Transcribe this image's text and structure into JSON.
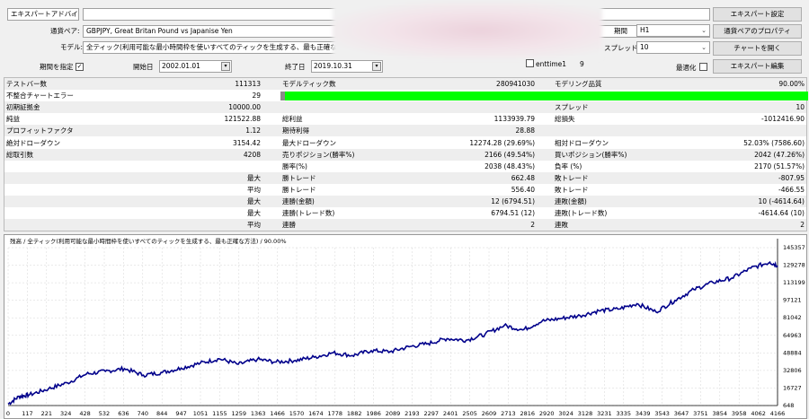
{
  "settings": {
    "expert_select": "エキスパートアドバイザ",
    "pair_label": "通貨ペア:",
    "pair_value": "GBPJPY, Great Britan Pound vs Japanise Yen",
    "model_label": "モデル:",
    "model_value": "全ティック(利用可能な最小時間枠を使いすべてのティックを生成する、最も正確な方法)",
    "use_date_label": "期間を指定",
    "use_date_checked": "✓",
    "from_label": "開始日",
    "from_value": "2002.01.01",
    "to_label": "終了日",
    "to_value": "2019.10.31",
    "param_label": "enttime1",
    "param_value": "9",
    "period_label": "期間",
    "period_value": "H1",
    "spread_label": "スプレッド",
    "spread_value": "10",
    "optimize_label": "最適化",
    "buttons": [
      "エキスパート設定",
      "通貨ペアのプロパティ",
      "チャートを開く",
      "エキスパート編集"
    ]
  },
  "stats": {
    "rows": [
      [
        "テストバー数",
        "111313",
        "モデルティック数",
        "280941030",
        "モデリング品質",
        "90.00%"
      ],
      [
        "不整合チャートエラー",
        "29",
        "",
        "",
        "",
        ""
      ],
      [
        "初期証拠金",
        "10000.00",
        "",
        "",
        "スプレッド",
        "10"
      ],
      [
        "純益",
        "121522.88",
        "総利益",
        "1133939.79",
        "総損失",
        "-1012416.90"
      ],
      [
        "プロフィットファクタ",
        "1.12",
        "期待利得",
        "28.88",
        "",
        ""
      ],
      [
        "絶対ドローダウン",
        "3154.42",
        "最大ドローダウン",
        "12274.28 (29.69%)",
        "相対ドローダウン",
        "52.03% (7586.60)"
      ],
      [
        "総取引数",
        "4208",
        "売りポジション(勝率%)",
        "2166 (49.54%)",
        "買いポジション(勝率%)",
        "2042 (47.26%)"
      ],
      [
        "",
        "",
        "勝率(%)",
        "2038 (48.43%)",
        "負率 (%)",
        "2170 (51.57%)"
      ],
      [
        "",
        "最大",
        "勝トレード",
        "662.48",
        "敗トレード",
        "-807.95"
      ],
      [
        "",
        "平均",
        "勝トレード",
        "556.40",
        "敗トレード",
        "-466.55"
      ],
      [
        "",
        "最大",
        "連勝(金額)",
        "12 (6794.51)",
        "連敗(金額)",
        "10 (-4614.64)"
      ],
      [
        "",
        "最大",
        "連勝(トレード数)",
        "6794.51 (12)",
        "連敗(トレード数)",
        "-4614.64 (10)"
      ],
      [
        "",
        "平均",
        "連勝",
        "2",
        "連敗",
        "2"
      ]
    ]
  },
  "chart_data": {
    "type": "line",
    "title": "残高 / 全ティック(利用可能な最小時間枠を使いすべてのティックを生成する、最も正確な方法) / 90.00%",
    "x_ticks": [
      "0",
      "117",
      "221",
      "324",
      "428",
      "532",
      "636",
      "740",
      "844",
      "947",
      "1051",
      "1155",
      "1259",
      "1363",
      "1466",
      "1570",
      "1674",
      "1778",
      "1882",
      "1986",
      "2089",
      "2193",
      "2297",
      "2401",
      "2505",
      "2609",
      "2713",
      "2816",
      "2920",
      "3024",
      "3128",
      "3231",
      "3335",
      "3439",
      "3543",
      "3647",
      "3751",
      "3854",
      "3958",
      "4062",
      "4166"
    ],
    "y_ticks": [
      "145357",
      "129278",
      "113199",
      "97121",
      "81042",
      "64963",
      "48884",
      "32806",
      "16727",
      "648"
    ],
    "ylim": [
      648,
      145357
    ],
    "x_max": 4208,
    "points": [
      [
        0,
        2000
      ],
      [
        60,
        9000
      ],
      [
        117,
        10500
      ],
      [
        221,
        16000
      ],
      [
        324,
        21500
      ],
      [
        428,
        29500
      ],
      [
        532,
        32000
      ],
      [
        636,
        34500
      ],
      [
        740,
        28500
      ],
      [
        844,
        31000
      ],
      [
        947,
        35000
      ],
      [
        1051,
        39500
      ],
      [
        1155,
        43500
      ],
      [
        1259,
        38500
      ],
      [
        1363,
        43000
      ],
      [
        1466,
        40500
      ],
      [
        1570,
        42000
      ],
      [
        1674,
        45000
      ],
      [
        1778,
        49000
      ],
      [
        1882,
        46500
      ],
      [
        1986,
        51000
      ],
      [
        2089,
        50000
      ],
      [
        2193,
        54500
      ],
      [
        2297,
        57500
      ],
      [
        2401,
        62000
      ],
      [
        2505,
        60500
      ],
      [
        2609,
        66000
      ],
      [
        2713,
        74000
      ],
      [
        2816,
        70000
      ],
      [
        2920,
        78000
      ],
      [
        3024,
        80500
      ],
      [
        3128,
        83000
      ],
      [
        3231,
        87500
      ],
      [
        3335,
        89000
      ],
      [
        3439,
        94000
      ],
      [
        3543,
        86500
      ],
      [
        3647,
        97000
      ],
      [
        3751,
        107000
      ],
      [
        3854,
        113500
      ],
      [
        3958,
        117500
      ],
      [
        4062,
        126500
      ],
      [
        4166,
        132000
      ],
      [
        4208,
        129000
      ]
    ],
    "line_color": "#00008b"
  }
}
